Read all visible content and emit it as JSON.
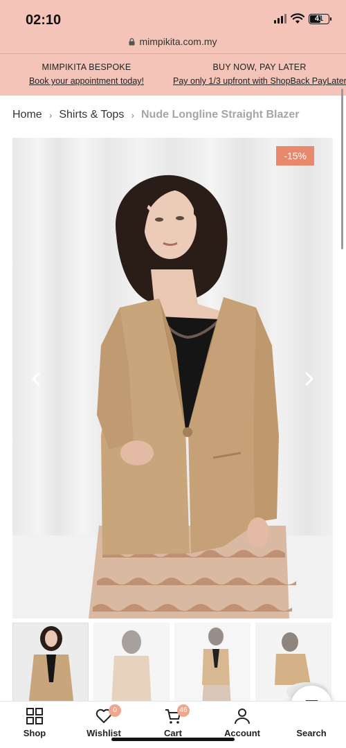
{
  "status_bar": {
    "time": "02:10",
    "battery": "41"
  },
  "browser": {
    "url": "mimpikita.com.my"
  },
  "promo": [
    {
      "title": "MIMPIKITA BESPOKE",
      "link": "Book your appointment today!"
    },
    {
      "title": "BUY NOW, PAY LATER",
      "link": "Pay only 1/3 upfront with ShopBack PayLater"
    }
  ],
  "breadcrumb": {
    "items": [
      "Home",
      "Shirts & Tops"
    ],
    "current": "Nude Longline Straight Blazer",
    "separator": "›"
  },
  "product": {
    "discount_badge": "-15%",
    "thumbnail_count": 4
  },
  "bottom_nav": {
    "items": [
      {
        "label": "Shop",
        "icon": "grid-icon"
      },
      {
        "label": "Wishlist",
        "icon": "heart-icon",
        "badge": "0"
      },
      {
        "label": "Cart",
        "icon": "cart-icon",
        "badge": "46"
      },
      {
        "label": "Account",
        "icon": "user-icon"
      },
      {
        "label": "Search",
        "icon": "chat-icon"
      }
    ]
  },
  "colors": {
    "header_bg": "#f3c4b7",
    "badge_bg": "#e8896d",
    "nav_badge": "#f0a58f",
    "blazer": "#c9a57b"
  }
}
